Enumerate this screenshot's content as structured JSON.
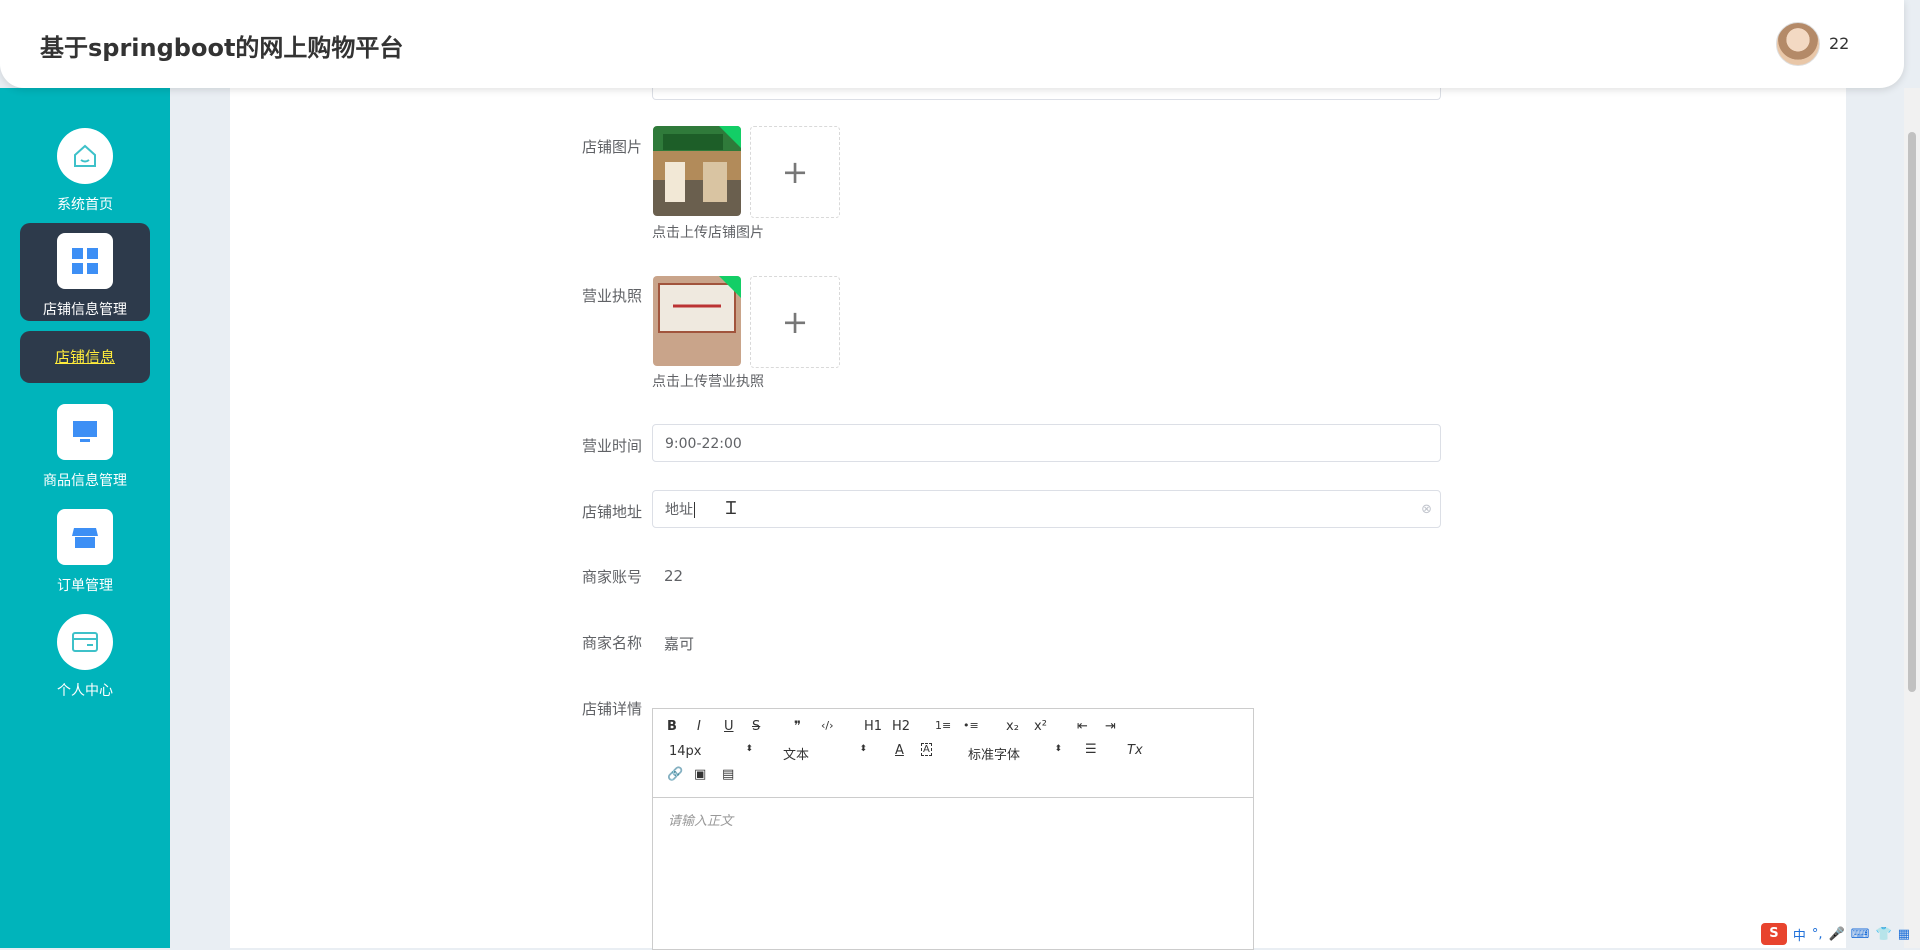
{
  "header": {
    "title": "基于springboot的网上购物平台",
    "username": "22"
  },
  "sidebar": {
    "items": [
      {
        "label": "系统首页",
        "icon": "home-icon"
      },
      {
        "label": "店铺信息管理",
        "icon": "grid-icon"
      },
      {
        "label": "商品信息管理",
        "icon": "monitor-icon"
      },
      {
        "label": "订单管理",
        "icon": "shop-icon"
      },
      {
        "label": "个人中心",
        "icon": "card-icon"
      }
    ],
    "sub_item": "店铺信息"
  },
  "form": {
    "shop_image_label": "店铺图片",
    "shop_image_hint": "点击上传店铺图片",
    "license_label": "营业执照",
    "license_hint": "点击上传营业执照",
    "hours_label": "营业时间",
    "hours_value": "9:00-22:00",
    "address_label": "店铺地址",
    "address_value": "地址",
    "account_label": "商家账号",
    "account_value": "22",
    "name_label": "商家名称",
    "name_value": "嘉可",
    "detail_label": "店铺详情",
    "plus": "+"
  },
  "editor": {
    "font_size": "14px",
    "block_type": "文本",
    "font_family": "标准字体",
    "placeholder": "请输入正文",
    "buttons": [
      "B",
      "I",
      "U",
      "S",
      "❞",
      "‹/›",
      "H1",
      "H2",
      "1≡",
      "•≡",
      "x₂",
      "x²",
      "⇤",
      "⇥"
    ]
  },
  "ime": {
    "label": "中"
  },
  "colors": {
    "sidebar": "#00b4bb",
    "active": "#2d3a4b",
    "sub_text": "#ffeb3b"
  }
}
